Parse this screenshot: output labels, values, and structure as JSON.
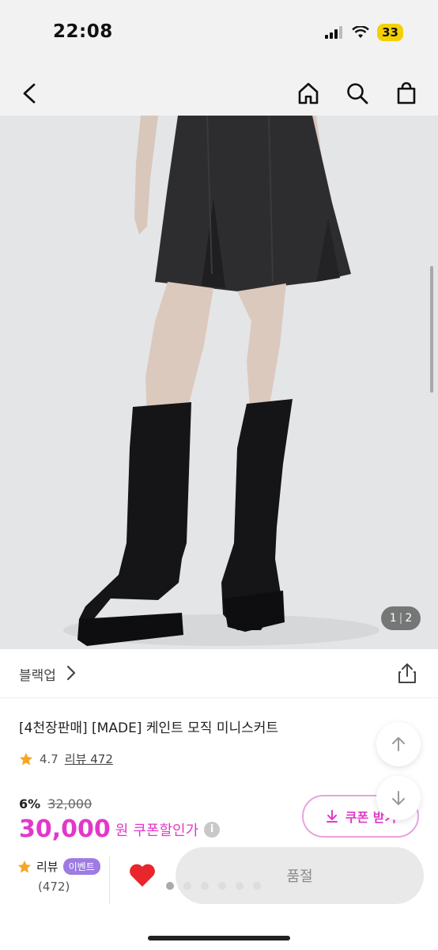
{
  "status_bar": {
    "time": "22:08",
    "battery": "33"
  },
  "nav": {
    "back": "back",
    "home": "home",
    "search": "search",
    "cart": "cart"
  },
  "gallery": {
    "counter_current": "1",
    "counter_total": "2"
  },
  "brand": {
    "name": "블랙업"
  },
  "product": {
    "title": "[4천장판매] [MADE] 케인트 모직 미니스커트",
    "rating": "4.7",
    "review_label": "리뷰 472"
  },
  "price": {
    "discount": "6%",
    "original": "32,000",
    "final": "30,000",
    "currency": "원",
    "coupon_price_label": "쿠폰할인가",
    "info": "i"
  },
  "coupon_button": {
    "label": "쿠폰 받기"
  },
  "bottom_bar": {
    "review_label": "리뷰",
    "event_badge": "이벤트",
    "review_count": "(472)",
    "buy_button": "품절"
  },
  "colors": {
    "accent": "#e238c9",
    "event": "#9d7be3",
    "heart": "#e8262b",
    "star": "#f5a623"
  }
}
